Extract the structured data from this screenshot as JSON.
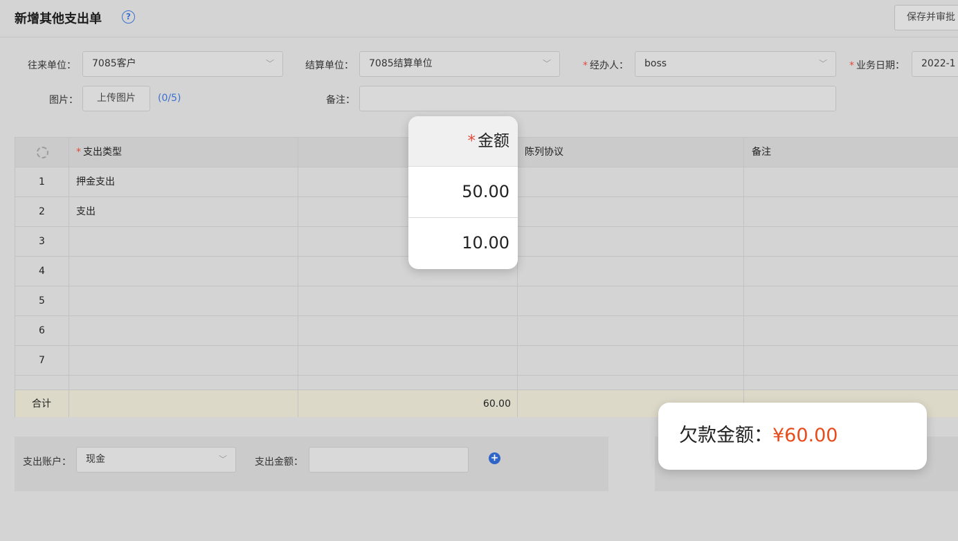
{
  "header": {
    "title": "新增其他支出单",
    "help_icon": "question-circle-icon",
    "save_button": "保存并审批"
  },
  "form": {
    "partner_label": "往来单位：",
    "partner_value": "7085客户",
    "settle_label": "结算单位：",
    "settle_value": "7085结算单位",
    "handler_label": "经办人：",
    "handler_value": "boss",
    "date_label": "业务日期：",
    "date_value": "2022-1",
    "image_label": "图片：",
    "upload_button": "上传图片",
    "upload_count": "(0/5)",
    "note_label": "备注：",
    "note_value": "",
    "required_mark": "*"
  },
  "table": {
    "columns": {
      "type": "支出类型",
      "amount": "金额",
      "display": "陈列协议",
      "note": "备注"
    },
    "rows": [
      {
        "index": "1",
        "type": "押金支出"
      },
      {
        "index": "2",
        "type": "支出"
      },
      {
        "index": "3",
        "type": ""
      },
      {
        "index": "4",
        "type": ""
      },
      {
        "index": "5",
        "type": ""
      },
      {
        "index": "6",
        "type": ""
      },
      {
        "index": "7",
        "type": ""
      }
    ],
    "total_label": "合计",
    "total_amount": "60.00"
  },
  "callout_amount": {
    "header": "金额",
    "values": [
      "50.00",
      "10.00"
    ]
  },
  "payment": {
    "account_label": "支出账户：",
    "account_value": "现金",
    "amount_label": "支出金额：",
    "amount_value": ""
  },
  "debt": {
    "label": "欠款金额：",
    "value": "¥60.00"
  },
  "colors": {
    "accent": "#3a6fd0",
    "required": "#e34a3a",
    "debt_amount": "#e84c1d",
    "total_row_bg": "#ddd9c8"
  }
}
